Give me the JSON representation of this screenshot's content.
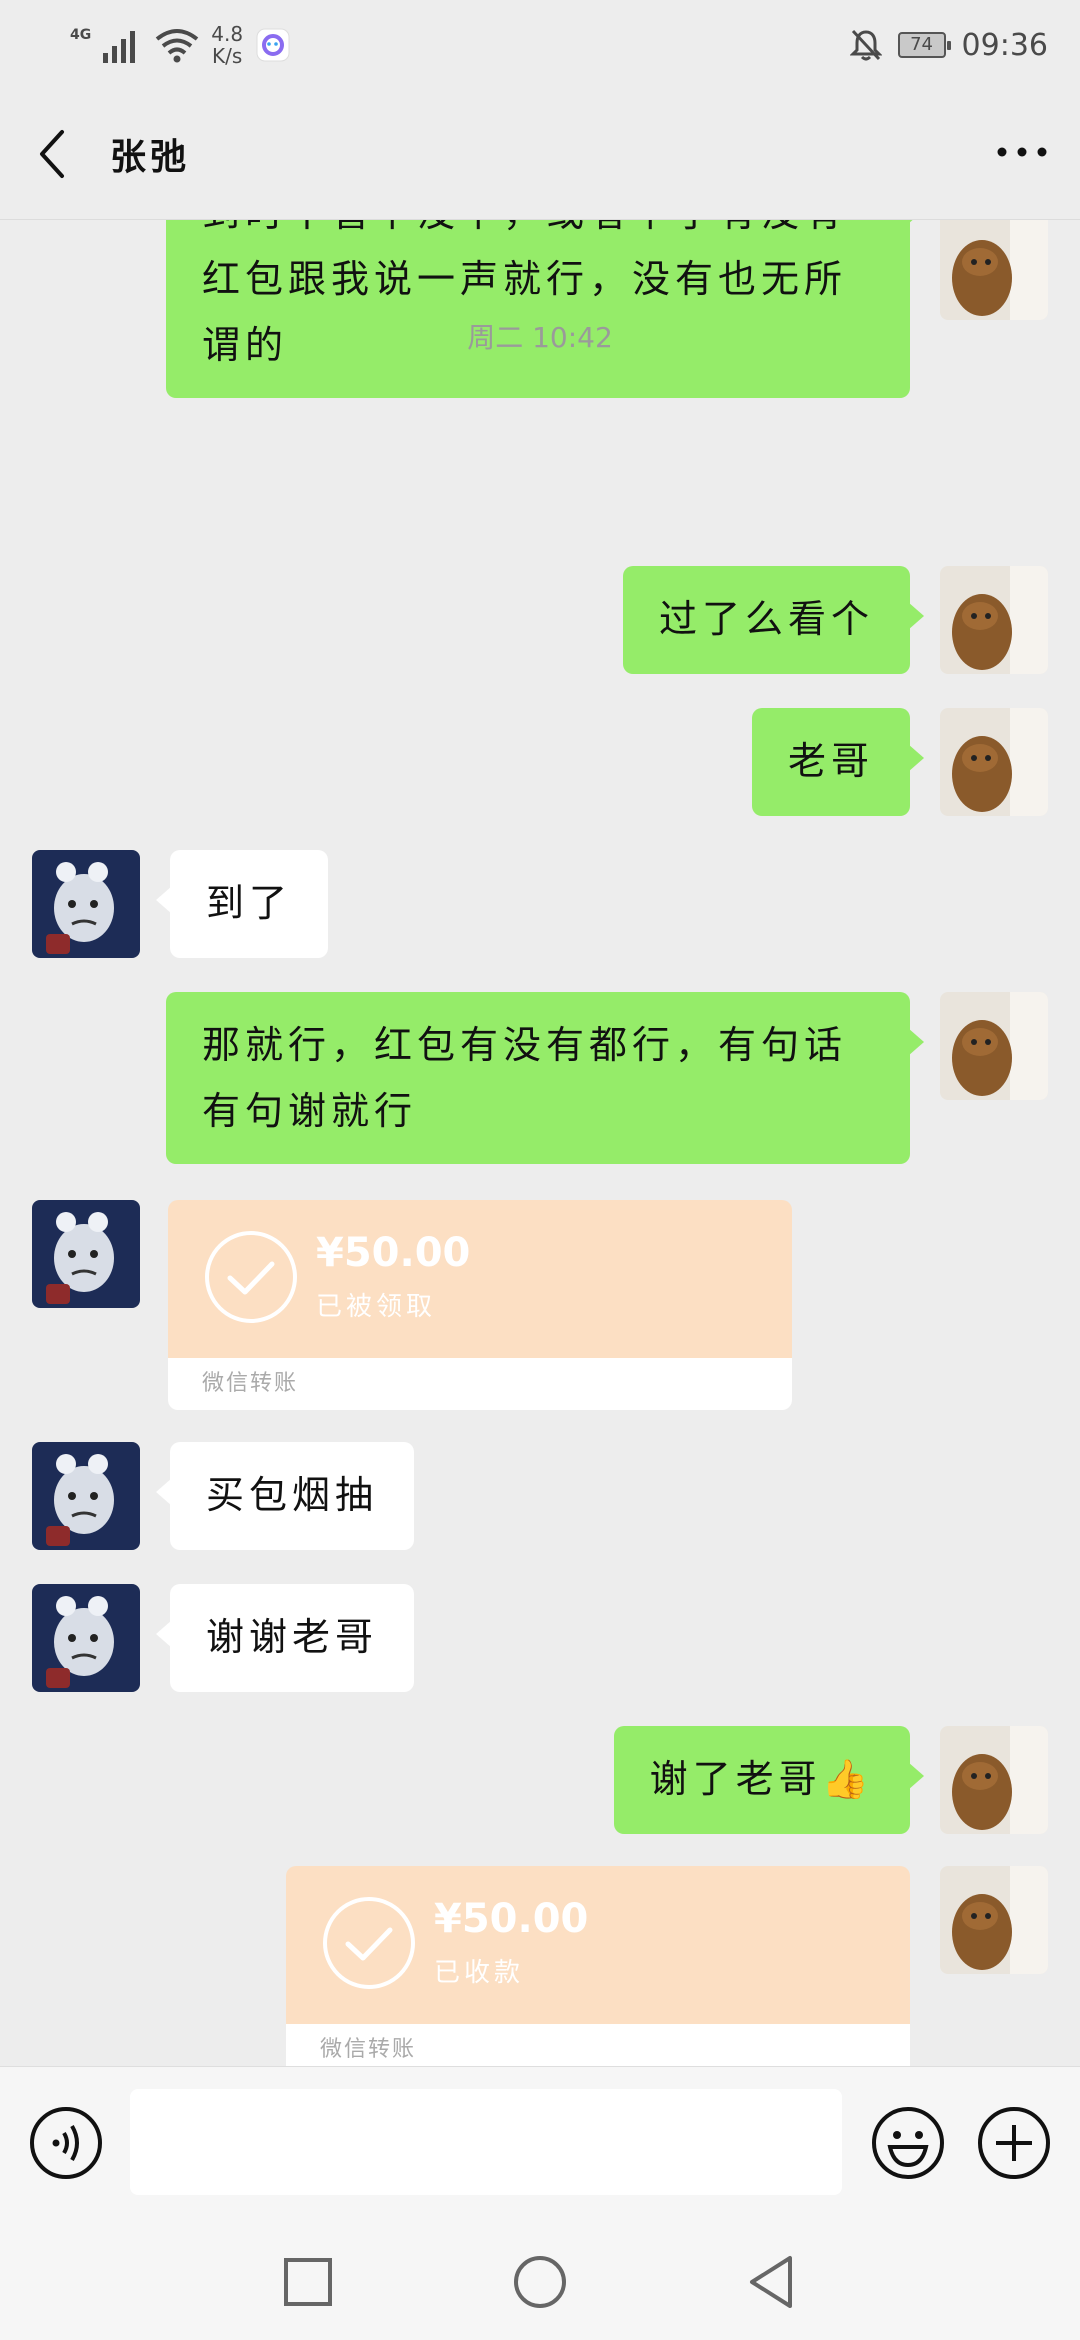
{
  "status_bar": {
    "network": "4G",
    "speed_value": "4.8",
    "speed_unit": "K/s",
    "battery": "74",
    "time": "09:36",
    "icons": [
      "signal-icon",
      "wifi-icon",
      "app-notification-icon",
      "mute-bell-icon",
      "battery-icon"
    ]
  },
  "header": {
    "contact_name": "张弛",
    "icons": [
      "back-icon",
      "more-icon"
    ]
  },
  "messages": {
    "m1": "到时不管下没下，或者下了有没有红包跟我说一声就行，没有也无所谓的",
    "timestamp": "周二 10:42",
    "m2": "过了么看个",
    "m3": "老哥",
    "m4": "到了",
    "m5": "那就行，红包有没有都行，有句话有句谢就行",
    "t1": {
      "amount": "¥50.00",
      "status": "已被领取",
      "label": "微信转账"
    },
    "m6": "买包烟抽",
    "m7": "谢谢老哥",
    "m8": "谢了老哥👍",
    "t2": {
      "amount": "¥50.00",
      "status": "已收款",
      "label": "微信转账"
    }
  },
  "input_bar": {
    "value": "",
    "icons": [
      "voice-icon",
      "emoji-icon",
      "plus-icon"
    ]
  },
  "nav_bar": {
    "icons": [
      "recents-icon",
      "home-icon",
      "back-nav-icon"
    ]
  },
  "colors": {
    "background": "#ededed",
    "my_bubble": "#95ec69",
    "other_bubble": "#ffffff",
    "transfer": "#fcdfc3"
  }
}
